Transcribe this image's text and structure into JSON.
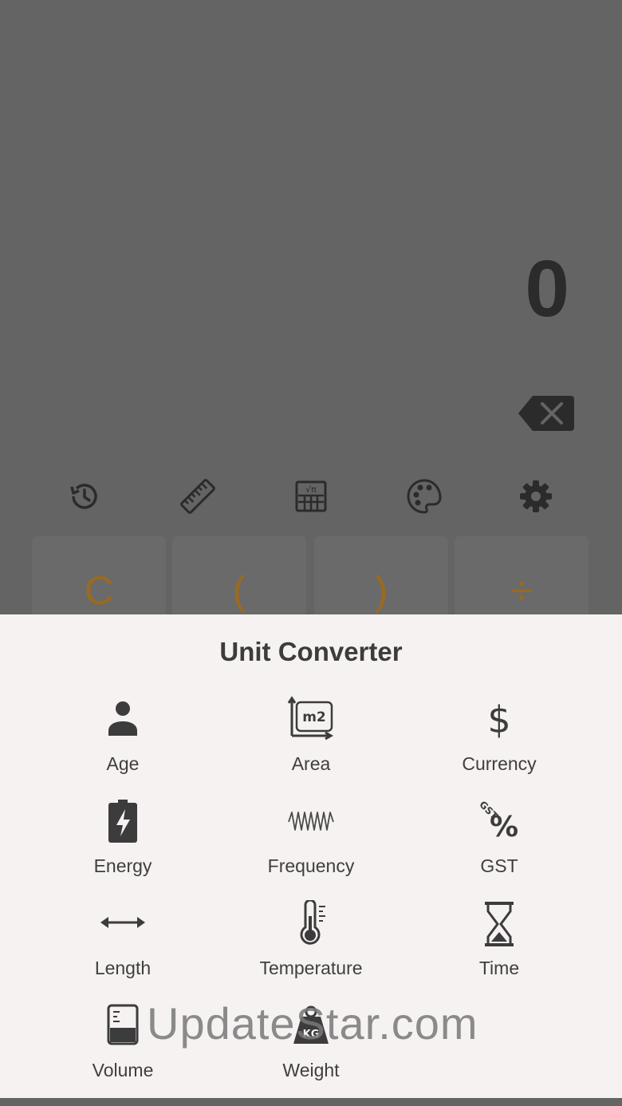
{
  "calculator": {
    "display_value": "0",
    "toolbar": [
      "history-icon",
      "ruler-icon",
      "scientific-icon",
      "palette-icon",
      "gear-icon"
    ],
    "keys": [
      "C",
      "(",
      ")",
      "÷"
    ],
    "accent_color": "#9b6a1e"
  },
  "sheet": {
    "title": "Unit Converter",
    "items": [
      {
        "label": "Age",
        "icon": "person-icon"
      },
      {
        "label": "Area",
        "icon": "area-icon"
      },
      {
        "label": "Currency",
        "icon": "dollar-icon"
      },
      {
        "label": "Energy",
        "icon": "battery-icon"
      },
      {
        "label": "Frequency",
        "icon": "wave-icon"
      },
      {
        "label": "GST",
        "icon": "gst-icon"
      },
      {
        "label": "Length",
        "icon": "arrows-icon"
      },
      {
        "label": "Temperature",
        "icon": "thermometer-icon"
      },
      {
        "label": "Time",
        "icon": "hourglass-icon"
      },
      {
        "label": "Volume",
        "icon": "beaker-icon"
      },
      {
        "label": "Weight",
        "icon": "kg-weight-icon"
      }
    ],
    "area_icon_text": "m2",
    "gst_icon_text": "GST",
    "weight_icon_text": "KG"
  },
  "watermark": "UpdateStar.com"
}
